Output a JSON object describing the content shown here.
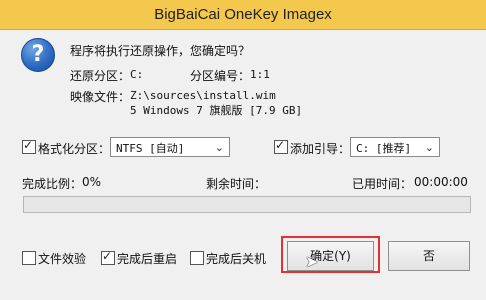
{
  "window": {
    "title": "BigBaiCai OneKey Imagex"
  },
  "dialog": {
    "question": "程序将执行还原操作，您确定吗？",
    "restore_partition_label": "还原分区：",
    "restore_partition_value": "C:",
    "partition_number_label": "分区编号：",
    "partition_number_value": "1:1",
    "image_file_label": "映像文件：",
    "image_file_path": "Z:\\sources\\install.wim",
    "image_file_desc": "5 Windows 7 旗舰版 [7.9 GB]"
  },
  "options": {
    "format_partition": {
      "label": "格式化分区：",
      "checked": true,
      "value": "NTFS [自动]"
    },
    "add_boot": {
      "label": "添加引导：",
      "checked": true,
      "value": "C: [推荐]"
    }
  },
  "progress": {
    "complete_label": "完成比例：",
    "complete_value": "0%",
    "remaining_label": "剩余时间：",
    "remaining_value": "",
    "elapsed_label": "已用时间：",
    "elapsed_value": "00:00:00",
    "fraction": 0
  },
  "bottom": {
    "file_verify": {
      "label": "文件效验",
      "checked": false
    },
    "restart_after": {
      "label": "完成后重启",
      "checked": true
    },
    "shutdown_after": {
      "label": "完成后关机",
      "checked": false
    },
    "ok_label": "确定(Y)",
    "cancel_label": "否"
  }
}
